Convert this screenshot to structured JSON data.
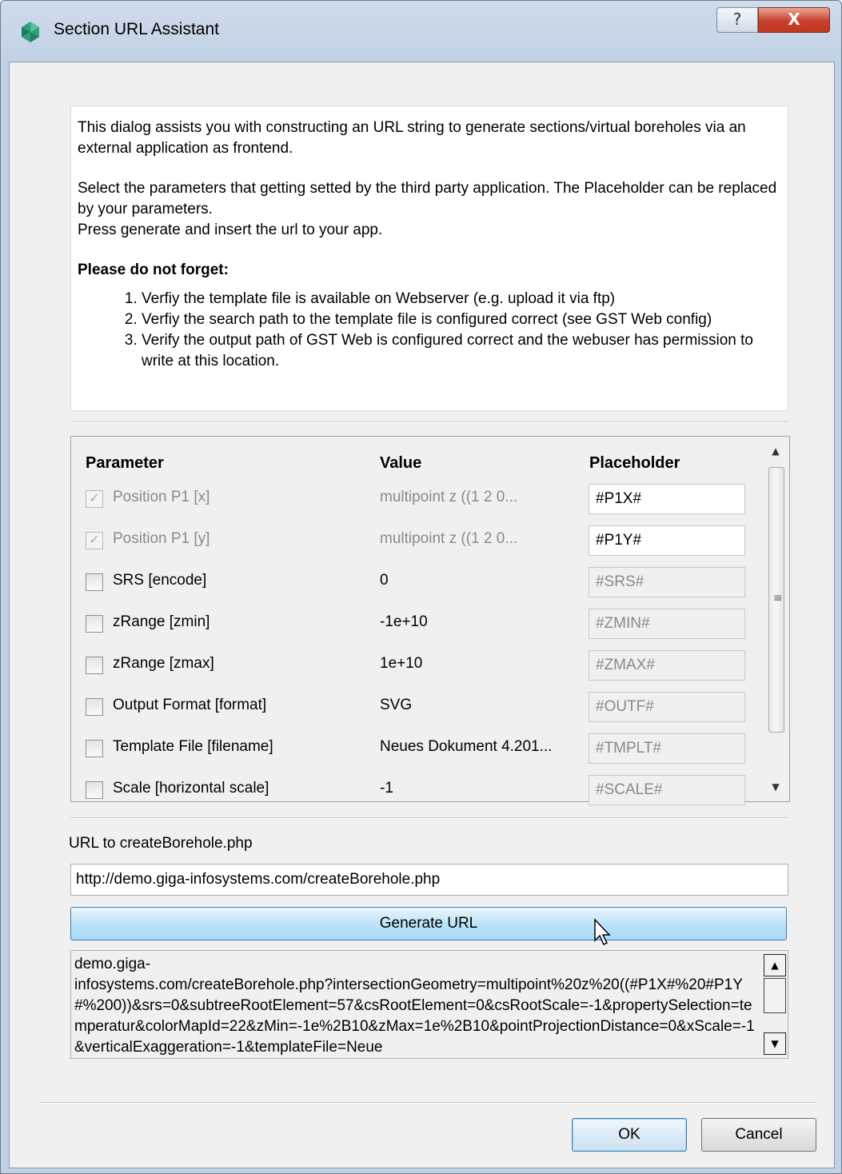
{
  "window": {
    "title": "Section URL Assistant",
    "help_label": "?",
    "close_label": "X"
  },
  "info": {
    "p1": "This dialog assists you with constructing an URL string to generate sections/virtual boreholes via an external application as frontend.",
    "p2a": "Select the parameters that getting setted by the third party application. The Placeholder can be replaced by your parameters.",
    "p2b": "Press generate and insert the url to your app.",
    "heading": "Please do not forget:",
    "items": [
      "Verfiy the template file is available on Webserver (e.g. upload it via ftp)",
      "Verfiy the search path to the template file is configured correct (see GST Web config)",
      "Verify the output path of GST Web is configured correct and the webuser has permission to write at this location."
    ]
  },
  "params": {
    "headers": {
      "parameter": "Parameter",
      "value": "Value",
      "placeholder": "Placeholder"
    },
    "rows": [
      {
        "name": "Position P1 [x]",
        "value": "multipoint z ((1 2 0...",
        "placeholder": "#P1X#",
        "checked": true
      },
      {
        "name": "Position P1 [y]",
        "value": "multipoint z ((1 2 0...",
        "placeholder": "#P1Y#",
        "checked": true
      },
      {
        "name": "SRS [encode]",
        "value": "0",
        "placeholder": "#SRS#",
        "checked": false
      },
      {
        "name": "zRange [zmin]",
        "value": "-1e+10",
        "placeholder": "#ZMIN#",
        "checked": false
      },
      {
        "name": "zRange [zmax]",
        "value": "1e+10",
        "placeholder": "#ZMAX#",
        "checked": false
      },
      {
        "name": "Output Format [format]",
        "value": "SVG",
        "placeholder": "#OUTF#",
        "checked": false
      },
      {
        "name": "Template File [filename]",
        "value": "Neues Dokument 4.201...",
        "placeholder": "#TMPLT#",
        "checked": false
      },
      {
        "name": "Scale [horizontal scale]",
        "value": "-1",
        "placeholder": "#SCALE#",
        "checked": false
      }
    ],
    "scroll_grip": "≡"
  },
  "url": {
    "label": "URL to createBorehole.php",
    "value": "http://demo.giga-infosystems.com/createBorehole.php"
  },
  "generate_label": "Generate URL",
  "result_text": "demo.giga-\ninfosystems.com/createBorehole.php?intersectionGeometry=multipoint%20z%20((#P1X#%20#P1Y#%200))&srs=0&subtreeRootElement=57&csRootElement=0&csRootScale=-1&propertySelection=temperatur&colorMapId=22&zMin=-1e%2B10&zMax=1e%2B10&pointProjectionDistance=0&xScale=-1&verticalExaggeration=-1&templateFile=Neue",
  "buttons": {
    "ok": "OK",
    "cancel": "Cancel"
  },
  "colors": {
    "accent": "#3c7fb1",
    "close": "#c7402b"
  }
}
